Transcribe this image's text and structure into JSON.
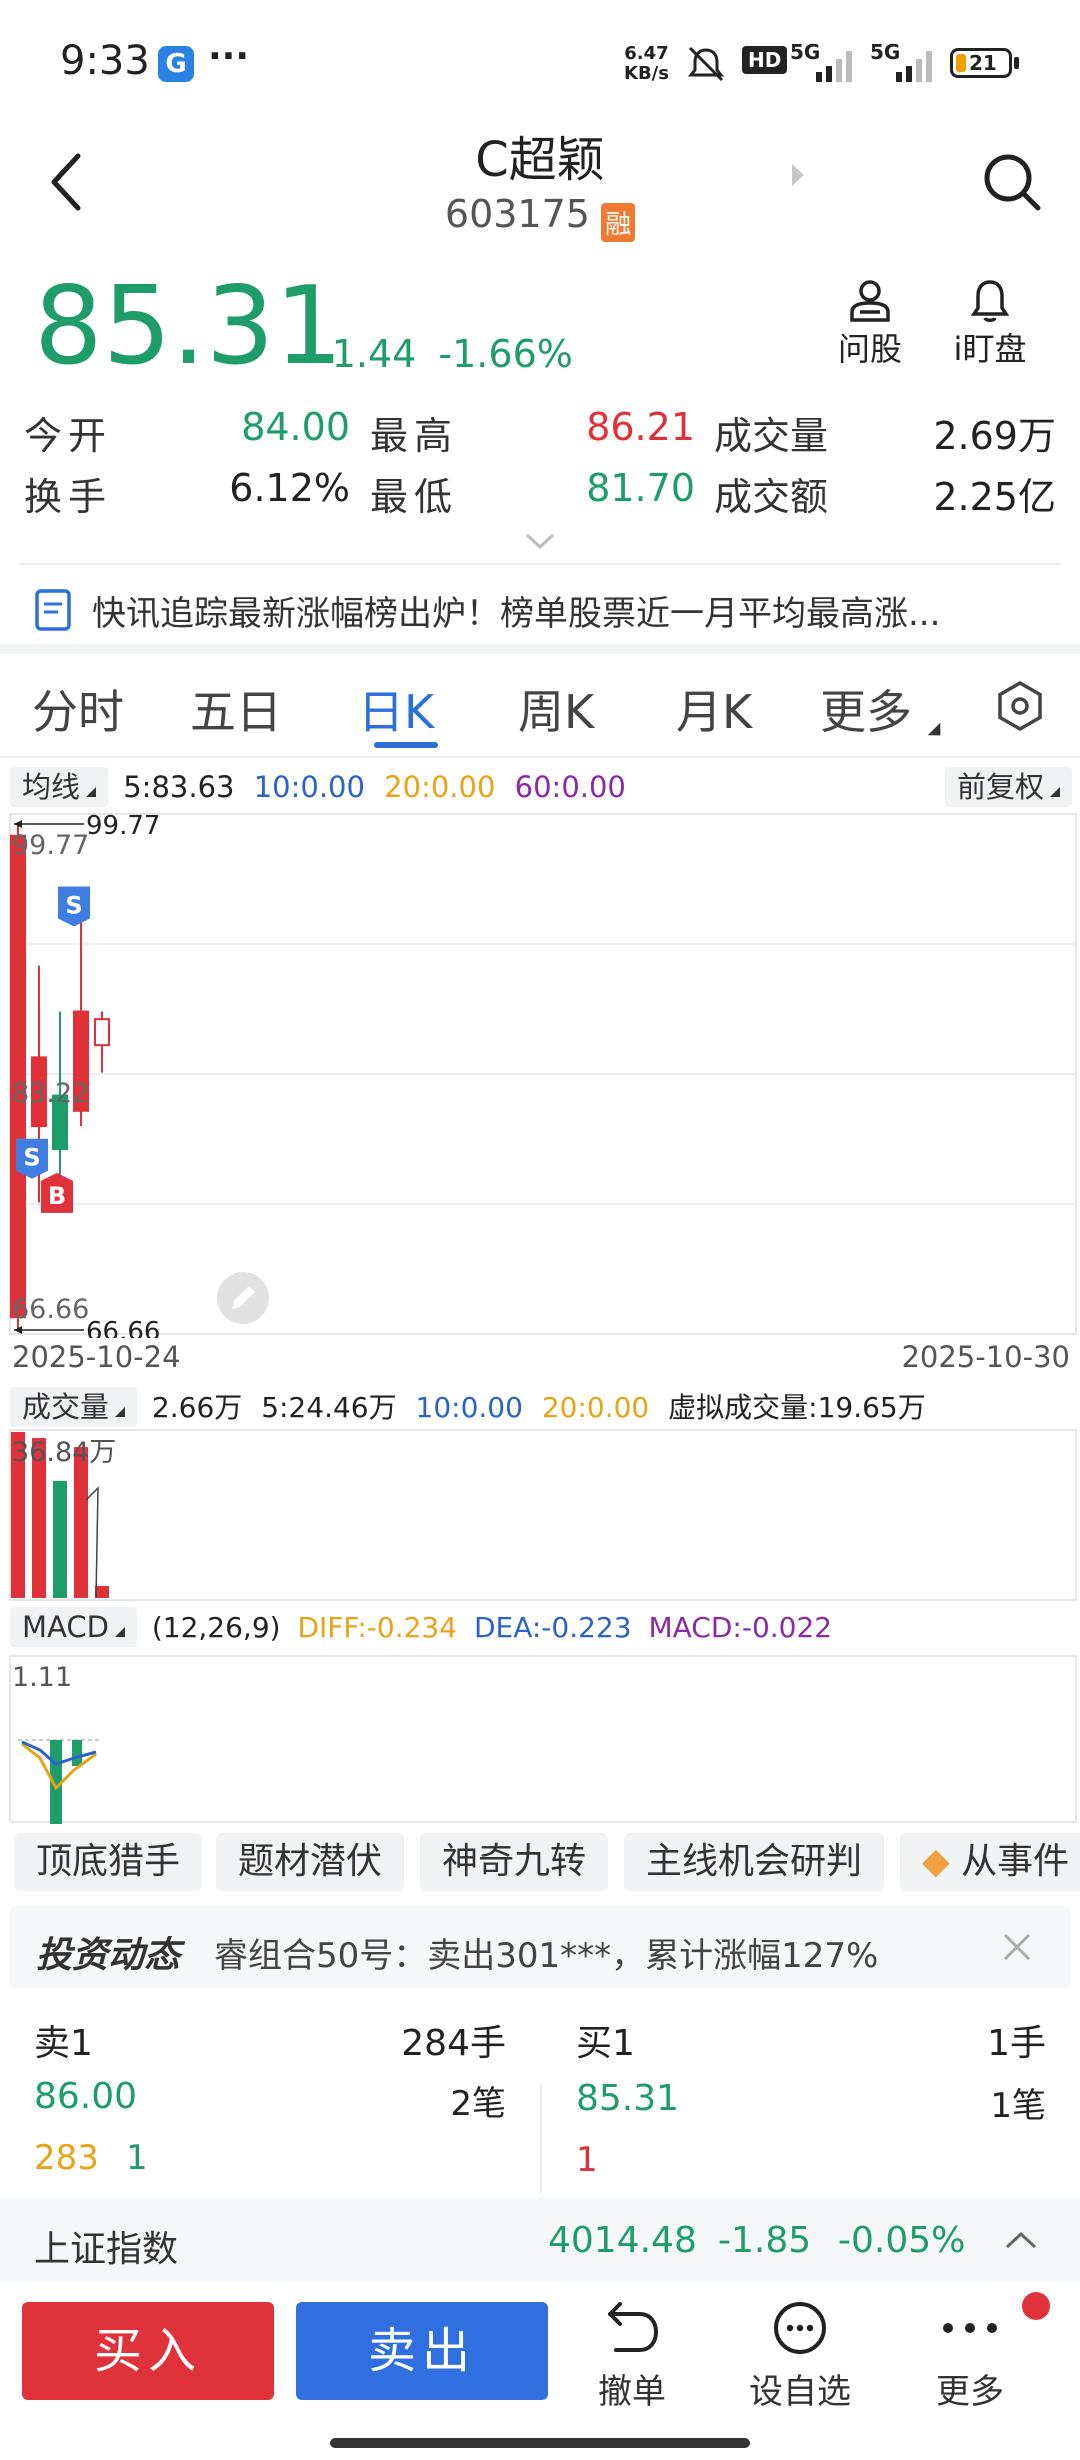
{
  "status_bar": {
    "time": "9:33",
    "more": "···",
    "net_speed_top": "6.47",
    "net_speed_bottom": "KB/s",
    "hd": "HD",
    "sig1": "5G",
    "sig2": "5G",
    "battery": "21"
  },
  "header": {
    "title": "C超颖",
    "code": "603175",
    "rong_badge": "融"
  },
  "price": {
    "current": "85.31",
    "change": "-1.44",
    "change_pct": "-1.66%",
    "ask_label": "问股",
    "watch_label": "i盯盘"
  },
  "quote": {
    "open_label": "今开",
    "open_value": "84.00",
    "high_label": "最高",
    "high_value": "86.21",
    "volume_label": "成交量",
    "volume_value": "2.69万",
    "turnover_label": "换手",
    "turnover_value": "6.12%",
    "low_label": "最低",
    "low_value": "81.70",
    "amount_label": "成交额",
    "amount_value": "2.25亿"
  },
  "news": {
    "text": "快讯追踪最新涨幅榜出炉！榜单股票近一月平均最高涨..."
  },
  "tabs": [
    "分时",
    "五日",
    "日K",
    "周K",
    "月K",
    "更多"
  ],
  "active_tab": "日K",
  "ma": {
    "dropdown": "均线",
    "ma5": "5:83.63",
    "ma10": "10:0.00",
    "ma20": "20:0.00",
    "ma60": "60:0.00",
    "adjust": "前复权"
  },
  "chart_data": {
    "type": "candlestick",
    "date_start": "2025-10-24",
    "date_end": "2025-10-30",
    "high_label": "99.77",
    "high_label_right": "99.77",
    "mid_label": "83.22",
    "low_label": "66.66",
    "low_label_right": "66.66",
    "ylim": [
      66.66,
      99.77
    ],
    "candles": [
      {
        "open": 99.0,
        "close": 67.5,
        "high": 99.77,
        "low": 66.66
      },
      {
        "open": 80.0,
        "close": 84.5,
        "high": 90.5,
        "low": 75.0
      },
      {
        "open": 78.5,
        "close": 82.0,
        "high": 87.5,
        "low": 76.5
      },
      {
        "open": 81.0,
        "close": 87.5,
        "high": 93.5,
        "low": 80.0
      },
      {
        "open": 87.0,
        "close": 85.3,
        "high": 87.5,
        "low": 83.5
      }
    ],
    "markers": [
      {
        "candle": 0,
        "type": "S",
        "value": 78.0
      },
      {
        "candle": 1,
        "type": "B",
        "value": 75.5
      },
      {
        "candle": 2,
        "type": "S",
        "value": 94.5
      }
    ]
  },
  "volume": {
    "dropdown": "成交量",
    "current": "2.66万",
    "ma5": "5:24.46万",
    "ma10": "10:0.00",
    "ma20": "20:0.00",
    "virtual": "虚拟成交量:19.65万",
    "max_label": "36.84万",
    "bars": [
      36.84,
      35.5,
      26.0,
      33.5,
      2.66
    ]
  },
  "macd": {
    "dropdown": "MACD",
    "params": "(12,26,9)",
    "diff": "DIFF:-0.234",
    "dea": "DEA:-0.223",
    "macd": "MACD:-0.022",
    "top_label": "1.11"
  },
  "tags": [
    "顶底猎手",
    "题材潜伏",
    "神奇九转",
    "主线机会研判",
    "从事件"
  ],
  "dynamic": {
    "logo": "投资动态",
    "text": "睿组合50号：卖出301***，累计涨幅127%"
  },
  "order_book": {
    "sell_label": "卖1",
    "sell_qty": "284手",
    "sell_price": "86.00",
    "sell_count": "2笔",
    "sell_detail1": "283",
    "sell_detail2": "1",
    "buy_label": "买1",
    "buy_qty": "1手",
    "buy_price": "85.31",
    "buy_count": "1笔",
    "buy_detail1": "1"
  },
  "index": {
    "name": "上证指数",
    "value": "4014.48",
    "change": "-1.85",
    "pct": "-0.05%"
  },
  "bottom": {
    "buy": "买入",
    "sell": "卖出",
    "cancel": "撤单",
    "watchlist": "设自选",
    "more": "更多"
  },
  "colors": {
    "up": "#e03038",
    "down": "#1e9d6a",
    "accent": "#2a6fdb",
    "ma10": "#2a64c8",
    "ma20": "#e8a317",
    "ma60": "#8a2aa8"
  }
}
